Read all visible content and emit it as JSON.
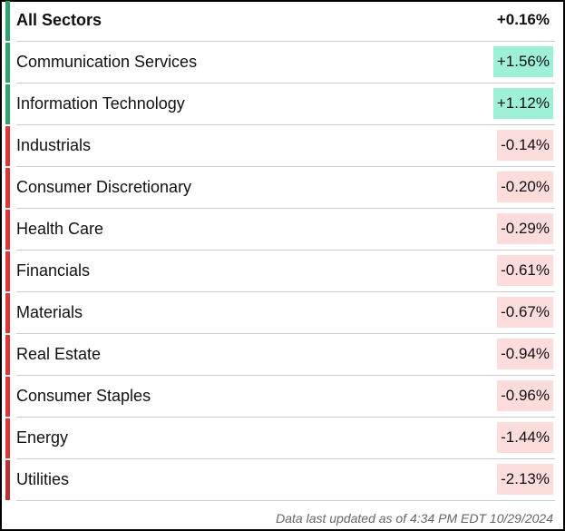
{
  "colors": {
    "up_bar": "#2fa36b",
    "down_bar": "#d9383a",
    "up_bg": "#9ef0d8",
    "down_bg": "#fddcdc"
  },
  "rows": [
    {
      "label": "All Sectors",
      "value": "+0.16%",
      "dir": "up",
      "bold": true
    },
    {
      "label": "Communication Services",
      "value": "+1.56%",
      "dir": "up"
    },
    {
      "label": "Information Technology",
      "value": "+1.12%",
      "dir": "up"
    },
    {
      "label": "Industrials",
      "value": "-0.14%",
      "dir": "down"
    },
    {
      "label": "Consumer Discretionary",
      "value": "-0.20%",
      "dir": "down"
    },
    {
      "label": "Health Care",
      "value": "-0.29%",
      "dir": "down"
    },
    {
      "label": "Financials",
      "value": "-0.61%",
      "dir": "down"
    },
    {
      "label": "Materials",
      "value": "-0.67%",
      "dir": "down"
    },
    {
      "label": "Real Estate",
      "value": "-0.94%",
      "dir": "down"
    },
    {
      "label": "Consumer Staples",
      "value": "-0.96%",
      "dir": "down"
    },
    {
      "label": "Energy",
      "value": "-1.44%",
      "dir": "down"
    },
    {
      "label": "Utilities",
      "value": "-2.13%",
      "dir": "down"
    }
  ],
  "footer": "Data last updated as of 4:34 PM EDT 10/29/2024"
}
